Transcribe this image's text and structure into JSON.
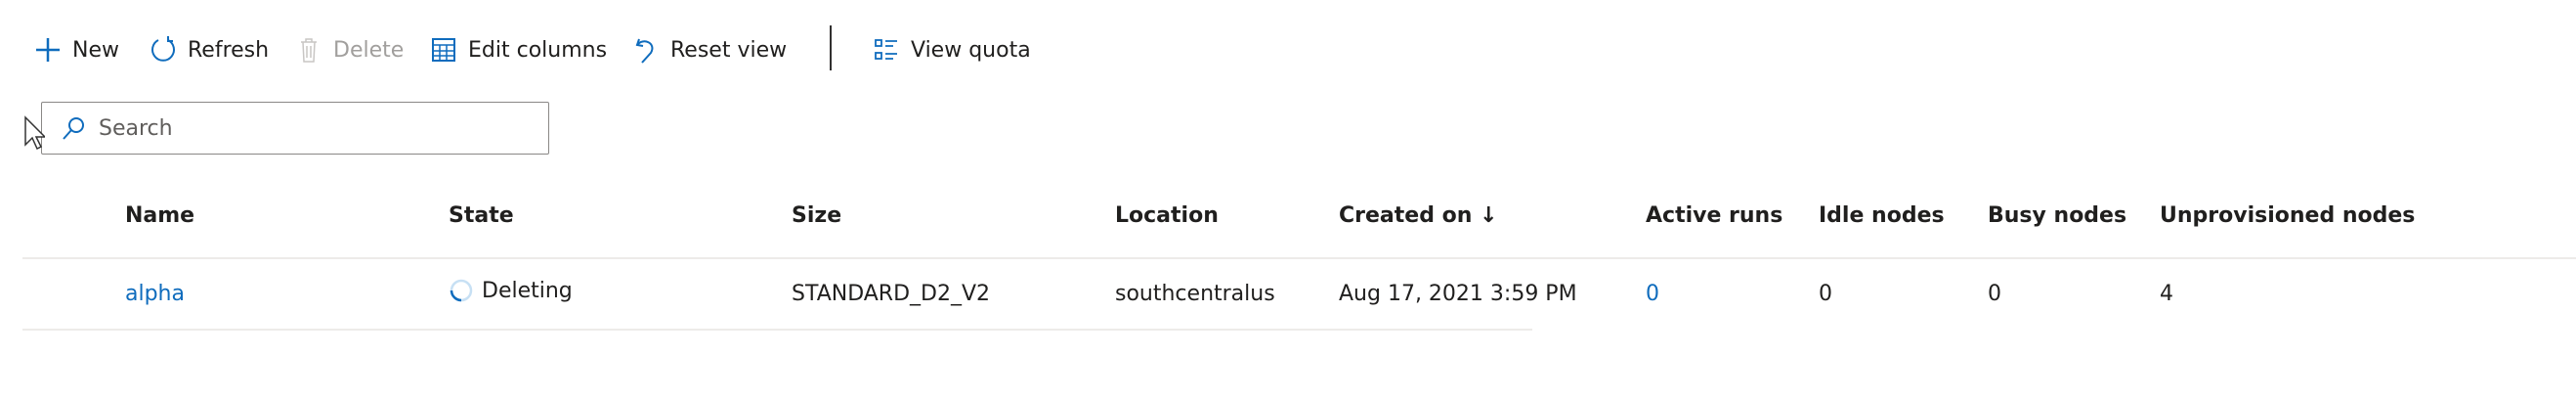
{
  "toolbar": {
    "new": "New",
    "refresh": "Refresh",
    "delete": "Delete",
    "edit_columns": "Edit columns",
    "reset_view": "Reset view",
    "view_quota": "View quota"
  },
  "search": {
    "placeholder": "Search"
  },
  "table": {
    "columns": [
      "Name",
      "State",
      "Size",
      "Location",
      "Created on ↓",
      "Active runs",
      "Idle nodes",
      "Busy nodes",
      "Unprovisioned nodes"
    ],
    "rows": [
      {
        "name": "alpha",
        "state": "Deleting",
        "size": "STANDARD_D2_V2",
        "location": "southcentralus",
        "created_on": "Aug 17, 2021 3:59 PM",
        "active_runs": "0",
        "idle_nodes": "0",
        "busy_nodes": "0",
        "unprovisioned_nodes": "4"
      }
    ]
  },
  "colors": {
    "accent": "#0f6cbd",
    "disabled": "#a19f9d",
    "divider": "#edebe9"
  }
}
